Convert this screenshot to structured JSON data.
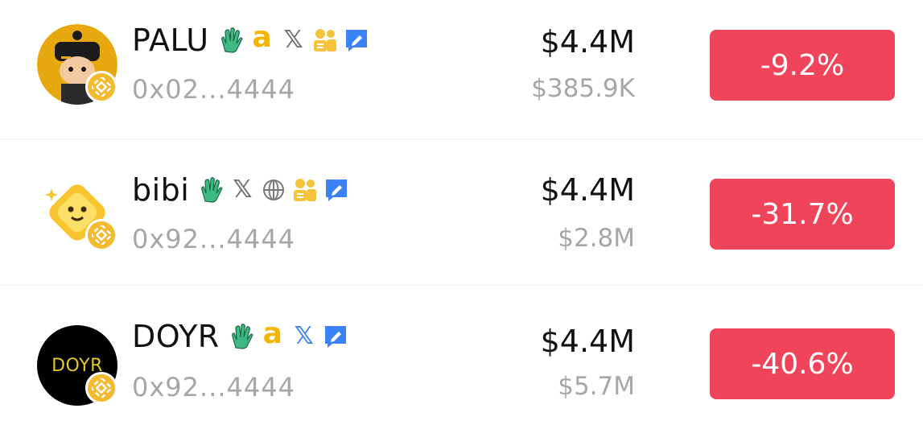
{
  "colors": {
    "negative": "#f0445a",
    "secondary_text": "#a6a6a6",
    "primary_text": "#111111",
    "chain_badge": "#f3ba2f",
    "x_blue": "#3b82f6",
    "social_green": "#3fb984"
  },
  "tokens": [
    {
      "name": "PALU",
      "address": "0x02...4444",
      "market_cap": "$4.4M",
      "volume": "$385.9K",
      "change": "-9.2%",
      "icons": [
        "wave-hand-icon",
        "ave-a-icon",
        "x-icon",
        "community-icon",
        "edit-icon"
      ]
    },
    {
      "name": "bibi",
      "address": "0x92...4444",
      "market_cap": "$4.4M",
      "volume": "$2.8M",
      "change": "-31.7%",
      "icons": [
        "wave-hand-icon",
        "x-icon",
        "globe-icon",
        "community-icon",
        "edit-icon"
      ]
    },
    {
      "name": "DOYR",
      "avatar_text": "DOYR",
      "address": "0x92...4444",
      "market_cap": "$4.4M",
      "volume": "$5.7M",
      "change": "-40.6%",
      "icons": [
        "wave-hand-icon",
        "ave-a-icon",
        "x-icon",
        "edit-icon"
      ]
    }
  ]
}
